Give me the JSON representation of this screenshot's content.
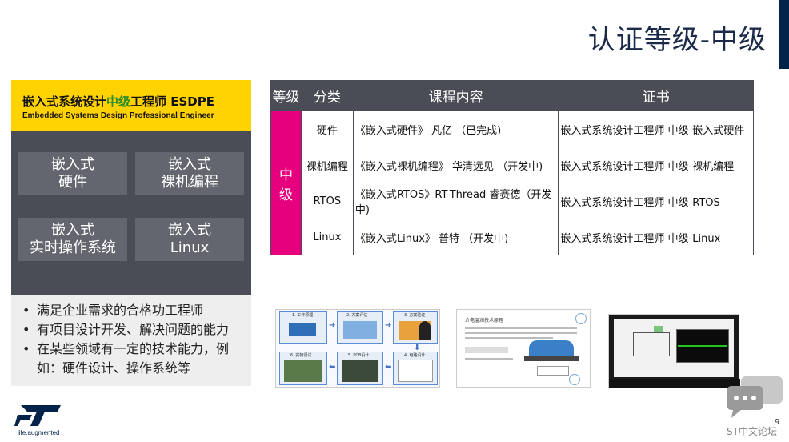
{
  "title": "认证等级-中级",
  "card": {
    "title_pre": "嵌入式系统设计",
    "title_hl": "中级",
    "title_post": "工程师 ESDPE",
    "subtitle": "Embedded Systems Design Professional Engineer",
    "tiles": [
      "嵌入式\n硬件",
      "嵌入式\n裸机编程",
      "嵌入式\n实时操作系统",
      "嵌入式\nLinux"
    ]
  },
  "bullets": [
    "满足企业需求的合格功工程师",
    "有项目设计开发、解决问题的能力",
    "在某些领域有一定的技术能力，例如：硬件设计、操作系统等"
  ],
  "table": {
    "headers": [
      "等级",
      "分类",
      "课程内容",
      "证书"
    ],
    "level": "中级",
    "rows": [
      {
        "cat": "硬件",
        "course": "《嵌入式硬件》 凡亿 （已完成)",
        "cert": "嵌入式系统设计工程师 中级-嵌入式硬件"
      },
      {
        "cat": "裸机编程",
        "course": "《嵌入式裸机编程》 华清远见 （开发中)",
        "cert": "嵌入式系统设计工程师 中级-裸机编程"
      },
      {
        "cat": "RTOS",
        "course": "《嵌入式RTOS》RT-Thread 睿赛德（开发中)",
        "cert": "嵌入式系统设计工程师 中级-RTOS"
      },
      {
        "cat": "Linux",
        "course": "《嵌入式Linux》 普特 （开发中)",
        "cert": "嵌入式系统设计工程师 中级-Linux"
      }
    ]
  },
  "thumb1": {
    "steps": [
      "1. 工作原理",
      "2. 方案评估",
      "3. 方案验证",
      "4. 电路设计",
      "5. PCB设计",
      "6. 实物调试"
    ]
  },
  "thumb2": {
    "heading": "介电温润技术原理"
  },
  "logo_text": "life.augmented",
  "page_number": "9",
  "forum": "ST中文论坛"
}
